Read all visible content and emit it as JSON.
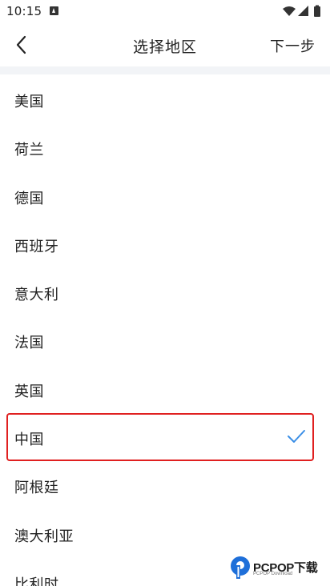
{
  "status_bar": {
    "time": "10:15",
    "app_icon": "a-notification-icon",
    "icons": [
      "wifi-icon",
      "signal-icon",
      "battery-icon"
    ]
  },
  "nav": {
    "back_icon": "chevron-left-icon",
    "title": "选择地区",
    "next_label": "下一步"
  },
  "regions": [
    {
      "label": "美国",
      "selected": false
    },
    {
      "label": "荷兰",
      "selected": false
    },
    {
      "label": "德国",
      "selected": false
    },
    {
      "label": "西班牙",
      "selected": false
    },
    {
      "label": "意大利",
      "selected": false
    },
    {
      "label": "法国",
      "selected": false
    },
    {
      "label": "英国",
      "selected": false
    },
    {
      "label": "中国",
      "selected": true
    },
    {
      "label": "阿根廷",
      "selected": false
    },
    {
      "label": "澳大利亚",
      "selected": false
    },
    {
      "label": "比利时",
      "selected": false
    }
  ],
  "watermark": {
    "brand": "PCPOP下载",
    "sub": "PCPOP Download"
  },
  "colors": {
    "selected_border": "#e02020",
    "check": "#3a8ee6",
    "divider": "#f2f4f7"
  }
}
